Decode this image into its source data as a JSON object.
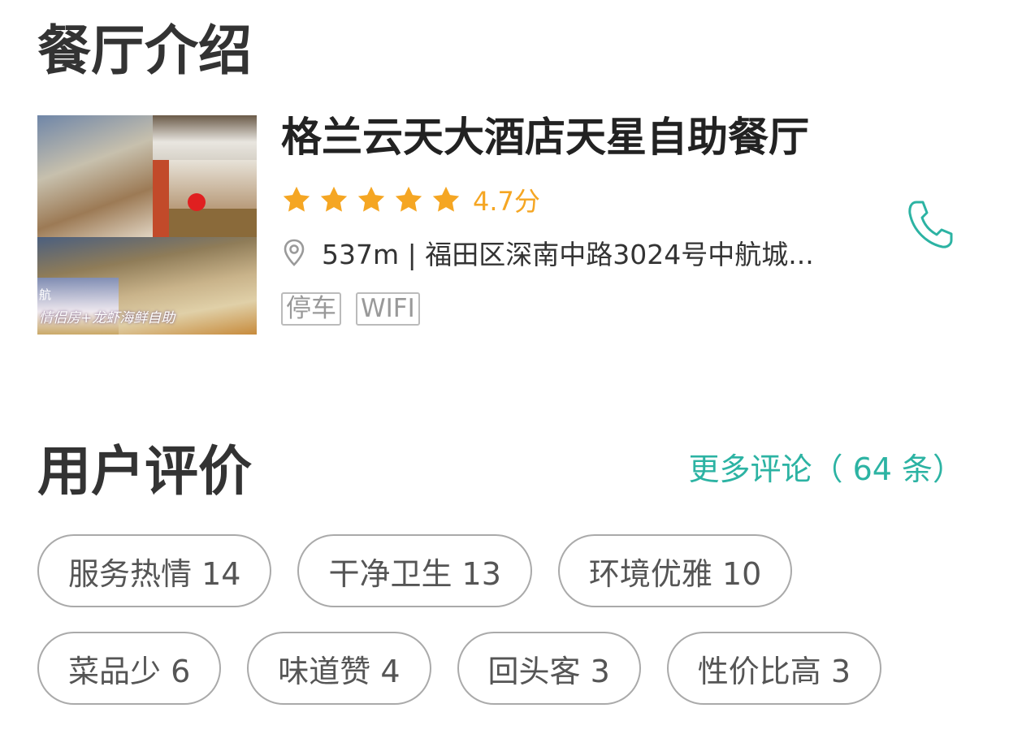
{
  "intro": {
    "section_title": "餐厅介绍",
    "thumbnail_caption": "情侣房+龙虾海鲜自助",
    "thumbnail_caption_2": "航",
    "restaurant": {
      "name": "格兰云天大酒店天星自助餐厅",
      "rating_stars": 5,
      "score_text": "4.7分",
      "address": "537m | 福田区深南中路3024号中航城...",
      "tags": [
        "停车",
        "WIFI"
      ]
    },
    "phone_icon": "phone-icon"
  },
  "reviews": {
    "section_title": "用户评价",
    "more_link": "更多评论（ 64 条）",
    "chips_row_1": [
      "服务热情 14",
      "干净卫生 13",
      "环境优雅 10"
    ],
    "chips_row_2": [
      "菜品少 6",
      "味道赞 4",
      "回头客 3",
      "性价比高 3"
    ]
  },
  "colors": {
    "accent_teal": "#2cb3a3",
    "star_orange": "#f5a623",
    "text_dark": "#333333",
    "chip_border": "#aaaaaa",
    "tag_grey": "#999999"
  }
}
